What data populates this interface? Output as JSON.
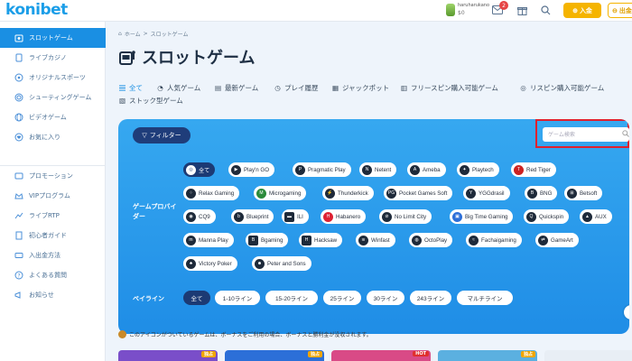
{
  "header": {
    "logo": "konibet",
    "user_name": "haruharukano",
    "balance": "$0",
    "notification_count": "2",
    "deposit_label": "入金",
    "withdraw_label": "出金"
  },
  "sidebar": {
    "items": [
      {
        "label": "スロットゲーム",
        "icon": "slot-icon"
      },
      {
        "label": "ライブカジノ",
        "icon": "card-icon"
      },
      {
        "label": "オリジナルスポーツ",
        "icon": "ball-icon"
      },
      {
        "label": "シューティングゲーム",
        "icon": "target-icon"
      },
      {
        "label": "ビデオゲーム",
        "icon": "globe-icon"
      },
      {
        "label": "お気に入り",
        "icon": "heart-icon"
      },
      {
        "label": "プロモーション",
        "icon": "megaphone-icon"
      },
      {
        "label": "VIPプログラム",
        "icon": "crown-icon"
      },
      {
        "label": "ライブRTP",
        "icon": "chart-icon"
      },
      {
        "label": "初心者ガイド",
        "icon": "book-icon"
      },
      {
        "label": "入出金方法",
        "icon": "coin-icon"
      },
      {
        "label": "よくある質問",
        "icon": "question-icon"
      },
      {
        "label": "お知らせ",
        "icon": "announcement-icon"
      }
    ]
  },
  "breadcrumb": {
    "home": "ホーム",
    "current": "スロットゲーム"
  },
  "page_title": "スロットゲーム",
  "tabs": [
    {
      "label": "全て"
    },
    {
      "label": "人気ゲーム"
    },
    {
      "label": "最新ゲーム"
    },
    {
      "label": "プレイ履歴"
    },
    {
      "label": "ジャックポット"
    },
    {
      "label": "フリースピン購入可能ゲーム"
    },
    {
      "label": "リスピン購入可能ゲーム"
    },
    {
      "label": "ストック型ゲーム"
    }
  ],
  "filter": {
    "button_label": "フィルター",
    "search_placeholder": "ゲーム検索",
    "provider_label": "ゲームプロバイダー",
    "providers": [
      "全て",
      "Play'n GO",
      "Pragmatic Play",
      "Netent",
      "Ameba",
      "Playtech",
      "Red Tiger",
      "Relax Gaming",
      "Microgaming",
      "Thunderkick",
      "Pocket Games Soft",
      "YGGdrasil",
      "BNG",
      "Betsoft",
      "CQ9",
      "Blueprint",
      "ILI",
      "Habanero",
      "No Limit City",
      "Big Time Gaming",
      "Quickspin",
      "AUX",
      "Manna Play",
      "Bgaming",
      "Hacksaw",
      "Winfast",
      "OctoPlay",
      "Fachaigaming",
      "GameArt",
      "Victory Poker",
      "Peter and Sons"
    ],
    "payline_label": "ペイライン",
    "paylines": [
      "全て",
      "1-10ライン",
      "15-20ライン",
      "25ライン",
      "30ライン",
      "243ライン",
      "マルチライン"
    ]
  },
  "notice": "このアイコンがついているゲームは、ボーナスをご利用の場合、ボーナスと勝利金が没収されます。",
  "cards": [
    {
      "tag": "独占",
      "color": "#7a4ec9"
    },
    {
      "tag": "独占",
      "color": "#2c6fd8"
    },
    {
      "tag": "HOT",
      "color": "#d94a86"
    },
    {
      "tag": "独占",
      "color": "#5bb0e0"
    },
    {
      "tag": "",
      "color": "#e8eef5"
    }
  ]
}
